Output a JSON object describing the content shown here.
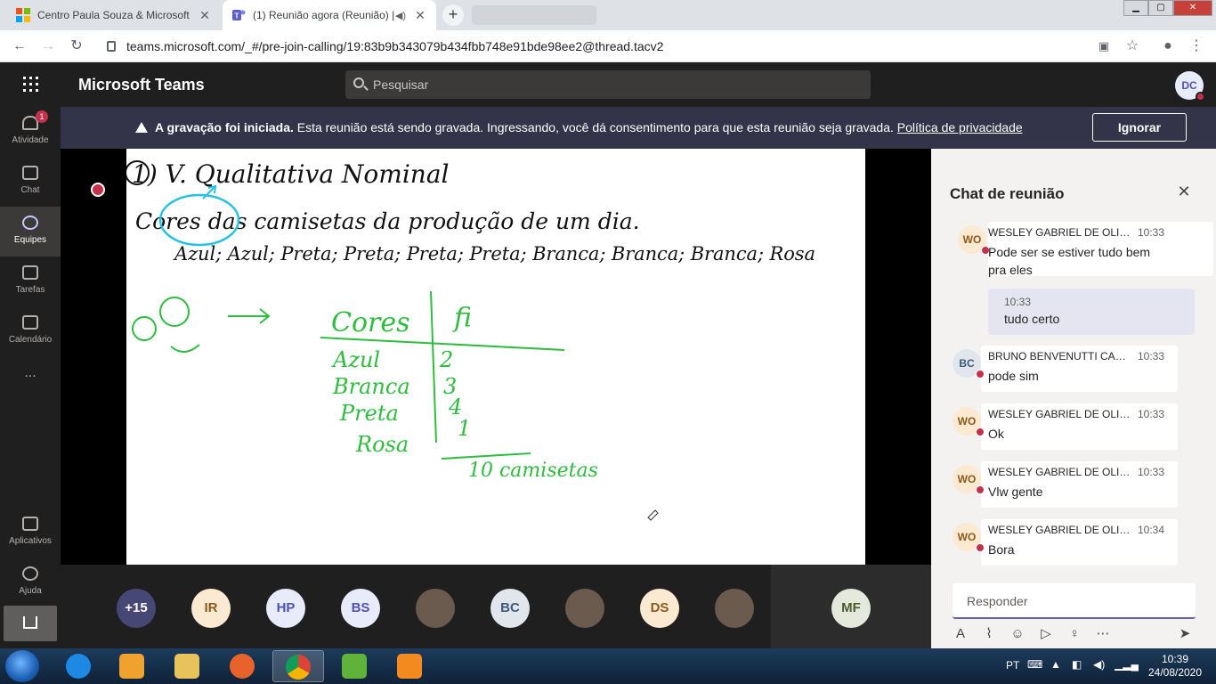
{
  "browser": {
    "tabs": [
      {
        "title": "Centro Paula Souza & Microsoft",
        "active": false
      },
      {
        "title": "(1) Reunião agora (Reunião) |",
        "active": true
      }
    ],
    "url": "teams.microsoft.com/_#/pre-join-calling/19:83b9b343079b434fbb748e91bde98ee2@thread.tacv2"
  },
  "teams": {
    "app_title": "Microsoft Teams",
    "search_placeholder": "Pesquisar",
    "me_initials": "DC"
  },
  "rail": [
    {
      "label": "Atividade",
      "badge": "1"
    },
    {
      "label": "Chat"
    },
    {
      "label": "Equipes",
      "selected": true
    },
    {
      "label": "Tarefas"
    },
    {
      "label": "Calendário"
    },
    {
      "label": "..."
    },
    {
      "label": "Aplicativos"
    },
    {
      "label": "Ajuda"
    }
  ],
  "banner": {
    "bold": "A gravação foi iniciada.",
    "text": "Esta reunião está sendo gravada. Ingressando, você dá consentimento para que esta reunião seja gravada.",
    "link": "Política de privacidade",
    "button": "Ignorar"
  },
  "whiteboard": {
    "heading": "1) V. Qualitativa Nominal",
    "line2": "Cores das camisetas da produção de um dia.",
    "line3": "Azul; Azul; Preta; Preta; Preta; Preta; Branca; Branca; Branca; Rosa",
    "table_col1": "Cores",
    "table_col2": "fi",
    "rows": [
      {
        "label": "Azul",
        "value": "2"
      },
      {
        "label": "Branca",
        "value": "3"
      },
      {
        "label": "Preta",
        "value": "4"
      },
      {
        "label": "Rosa",
        "value": "1"
      }
    ],
    "total": "10 camisetas"
  },
  "participants": [
    {
      "label": "+15",
      "bg": "#464775",
      "fg": "#ffffff"
    },
    {
      "label": "IR",
      "bg": "#fbe9d2",
      "fg": "#8a5a1b"
    },
    {
      "label": "HP",
      "bg": "#e8ebfa",
      "fg": "#4f52b2"
    },
    {
      "label": "BS",
      "bg": "#e8ebfa",
      "fg": "#4f52b2"
    },
    {
      "label": "",
      "photo": true
    },
    {
      "label": "BC",
      "bg": "#e1e6ec",
      "fg": "#3d5a78"
    },
    {
      "label": "",
      "photo": true
    },
    {
      "label": "DS",
      "bg": "#fbe9d2",
      "fg": "#8a5a1b"
    },
    {
      "label": "",
      "photo": true
    },
    {
      "label": "MF",
      "bg": "#e5e9dc",
      "fg": "#4a5a2c"
    }
  ],
  "chat": {
    "title": "Chat de reunião",
    "messages": [
      {
        "initials": "WO",
        "name": "WESLEY GABRIEL DE OLIVE...",
        "time": "10:33",
        "text": "Pode ser se estiver tudo bem pra eles"
      },
      {
        "mine": true,
        "time": "10:33",
        "text": "tudo certo"
      },
      {
        "initials": "BC",
        "name": "BRUNO BENVENUTTI CAST...",
        "time": "10:33",
        "text": "pode sim"
      },
      {
        "initials": "WO",
        "name": "WESLEY GABRIEL DE OLIVE...",
        "time": "10:33",
        "text": "Ok"
      },
      {
        "initials": "WO",
        "name": "WESLEY GABRIEL DE OLIVE...",
        "time": "10:33",
        "text": "Vlw gente"
      },
      {
        "initials": "WO",
        "name": "WESLEY GABRIEL DE OLIVE...",
        "time": "10:34",
        "text": "Bora"
      }
    ],
    "reply_placeholder": "Responder"
  },
  "taskbar": {
    "lang": "PT",
    "time": "10:39",
    "date": "24/08/2020"
  }
}
